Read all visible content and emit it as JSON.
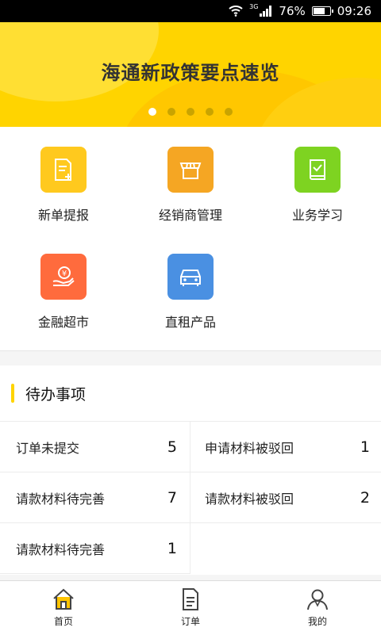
{
  "status_bar": {
    "network": "3G",
    "battery_pct": "76%",
    "battery_level": 0.76,
    "time": "09:26"
  },
  "banner": {
    "title": "海通新政策要点速览",
    "page_count": 5,
    "active_page": 1,
    "color": "#ffd400"
  },
  "shortcuts": [
    {
      "label": "新单提报",
      "icon": "new-order-icon",
      "color": "#ffc91e"
    },
    {
      "label": "经销商管理",
      "icon": "store-icon",
      "color": "#f5a623"
    },
    {
      "label": "业务学习",
      "icon": "book-icon",
      "color": "#7ed321"
    },
    {
      "label": "金融超市",
      "icon": "finance-icon",
      "color": "#ff6b3d"
    },
    {
      "label": "直租产品",
      "icon": "car-icon",
      "color": "#4a90e2"
    }
  ],
  "todo": {
    "title": "待办事项",
    "items": [
      {
        "label": "订单未提交",
        "count": "5"
      },
      {
        "label": "申请材料被驳回",
        "count": "1"
      },
      {
        "label": "请款材料待完善",
        "count": "7"
      },
      {
        "label": "请款材料被驳回",
        "count": "2"
      },
      {
        "label": "请款材料待完善",
        "count": "1"
      }
    ]
  },
  "tabbar": {
    "tabs": [
      {
        "label": "首页",
        "icon": "home-icon",
        "active": true
      },
      {
        "label": "订单",
        "icon": "order-icon",
        "active": false
      },
      {
        "label": "我的",
        "icon": "profile-icon",
        "active": false
      }
    ],
    "active_color": "#ffc400"
  }
}
